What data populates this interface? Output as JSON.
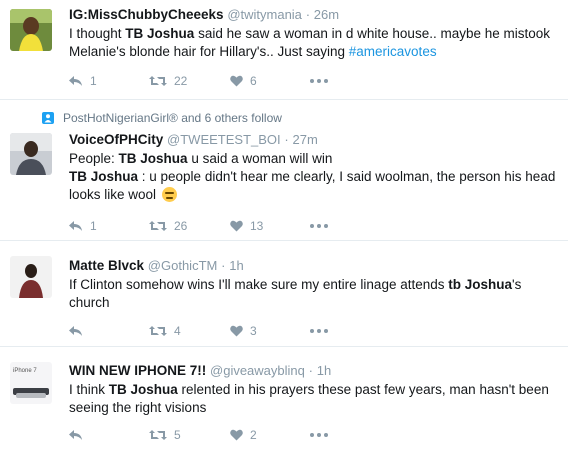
{
  "tweets": [
    {
      "name": "IG:MissChubbyCheeeks",
      "handle": "@twitymania",
      "dot": "·",
      "time": "26m",
      "text_parts": [
        "I thought ",
        "TB Joshua",
        " said he saw a woman in d white house.. maybe he mistook Melanie's blonde hair for Hillary's.. Just saying ",
        "#americavotes"
      ],
      "replies": "1",
      "retweets": "22",
      "likes": "6"
    },
    {
      "context": "PostHotNigerianGirl® and 6 others follow",
      "name": "VoiceOfPHCity",
      "handle": "@TWEETEST_BOI",
      "dot": "·",
      "time": "27m",
      "line1_parts": [
        "People: ",
        "TB Joshua",
        " u said a woman will win"
      ],
      "line2_parts": [
        "TB Joshua",
        " : u people didn't hear me clearly, I said woolman, the person his head looks like wool"
      ],
      "emoji": "persevering-face-emoji",
      "replies": "1",
      "retweets": "26",
      "likes": "13"
    },
    {
      "name": "Matte Blvck",
      "handle": "@GothicTM",
      "dot": "·",
      "time": "1h",
      "text_parts": [
        "If Clinton somehow wins I'll make sure my entire linage attends ",
        "tb Joshua",
        "'s church"
      ],
      "replies": "",
      "retweets": "4",
      "likes": "3"
    },
    {
      "name": "WIN NEW IPHONE 7!!",
      "handle": "@giveawayblinq",
      "dot": "·",
      "time": "1h",
      "text_parts": [
        "I think ",
        "TB Joshua",
        " relented in his prayers these past few years, man hasn't been seeing the right visions"
      ],
      "avatar_text": "iPhone 7",
      "replies": "",
      "retweets": "5",
      "likes": "2"
    }
  ],
  "colors": {
    "text": "#14171a",
    "meta": "#8899a6",
    "link": "#1b95e0",
    "context_icon": "#1da1f2",
    "divider": "#e6ecf0"
  },
  "icons": [
    "reply-icon",
    "retweet-icon",
    "like-icon",
    "more-icon",
    "follow-context-icon"
  ]
}
